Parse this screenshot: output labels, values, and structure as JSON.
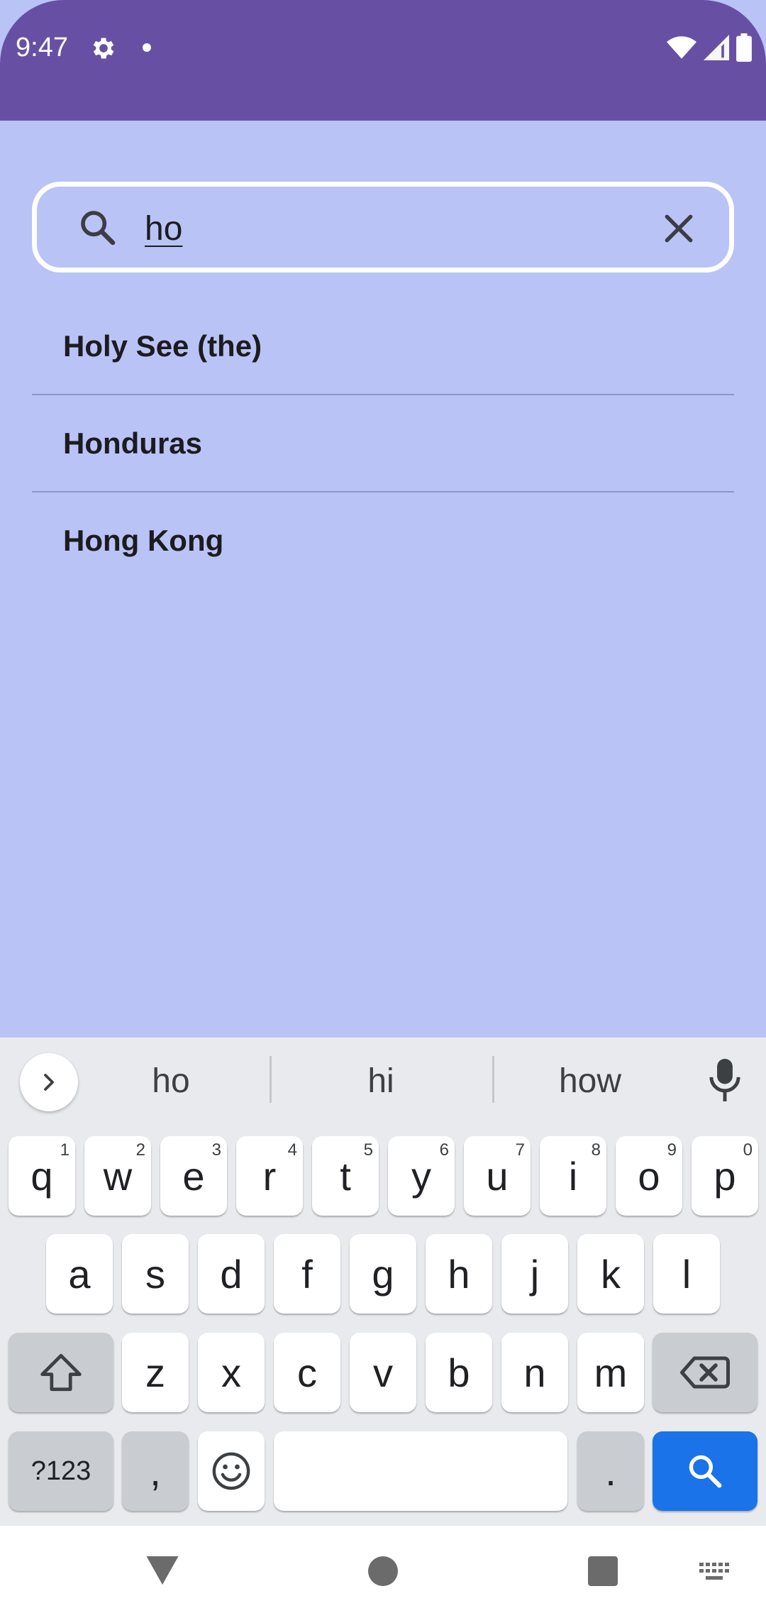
{
  "status_bar": {
    "time": "9:47"
  },
  "search": {
    "query": "ho"
  },
  "results": [
    {
      "label": "Holy See (the)"
    },
    {
      "label": "Honduras"
    },
    {
      "label": "Hong Kong"
    }
  ],
  "keyboard": {
    "suggestions": [
      "ho",
      "hi",
      "how"
    ],
    "row1": [
      {
        "key": "q",
        "hint": "1"
      },
      {
        "key": "w",
        "hint": "2"
      },
      {
        "key": "e",
        "hint": "3"
      },
      {
        "key": "r",
        "hint": "4"
      },
      {
        "key": "t",
        "hint": "5"
      },
      {
        "key": "y",
        "hint": "6"
      },
      {
        "key": "u",
        "hint": "7"
      },
      {
        "key": "i",
        "hint": "8"
      },
      {
        "key": "o",
        "hint": "9"
      },
      {
        "key": "p",
        "hint": "0"
      }
    ],
    "row2": [
      "a",
      "s",
      "d",
      "f",
      "g",
      "h",
      "j",
      "k",
      "l"
    ],
    "row3": [
      "z",
      "x",
      "c",
      "v",
      "b",
      "n",
      "m"
    ],
    "symbols_label": "?123",
    "comma": ",",
    "period": "."
  },
  "colors": {
    "status_bar": "#6750a4",
    "background": "#b9c3f5",
    "search_key": "#1a73e8"
  }
}
